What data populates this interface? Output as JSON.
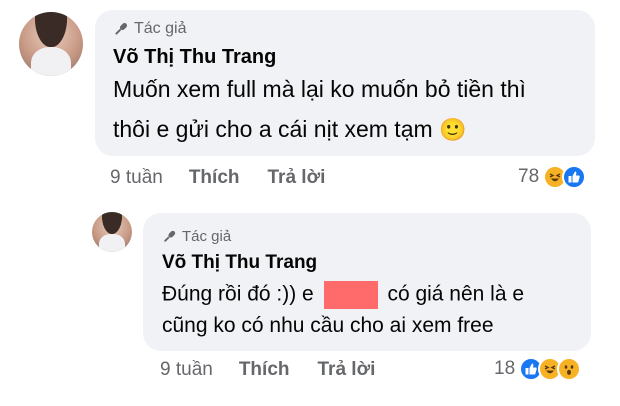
{
  "comments": [
    {
      "tag": "Tác giả",
      "author": "Võ Thị Thu Trang",
      "lines": [
        "Muốn xem full mà lại ko muốn bỏ tiền thì",
        "thôi e gửi cho a cái nịt xem tạm"
      ],
      "emoji": "🙂",
      "time": "9 tuần",
      "like_label": "Thích",
      "reply_label": "Trả lời",
      "reaction_count": "78",
      "reactions": [
        "haha",
        "like"
      ]
    },
    {
      "tag": "Tác giả",
      "author": "Võ Thị Thu Trang",
      "line1_a": "Đúng rồi đó :)) e",
      "line1_b": "có giá nên là e",
      "line2": "cũng ko có nhu cầu cho ai xem free",
      "time": "9 tuần",
      "like_label": "Thích",
      "reply_label": "Trả lời",
      "reaction_count": "18",
      "reactions": [
        "like",
        "haha",
        "wow"
      ]
    }
  ],
  "colors": {
    "bubble": "#f0f2f5",
    "meta": "#65676b",
    "like": "#1877f2",
    "emoji_yellow": "#f7b125",
    "redaction": "#ff6b6b"
  }
}
